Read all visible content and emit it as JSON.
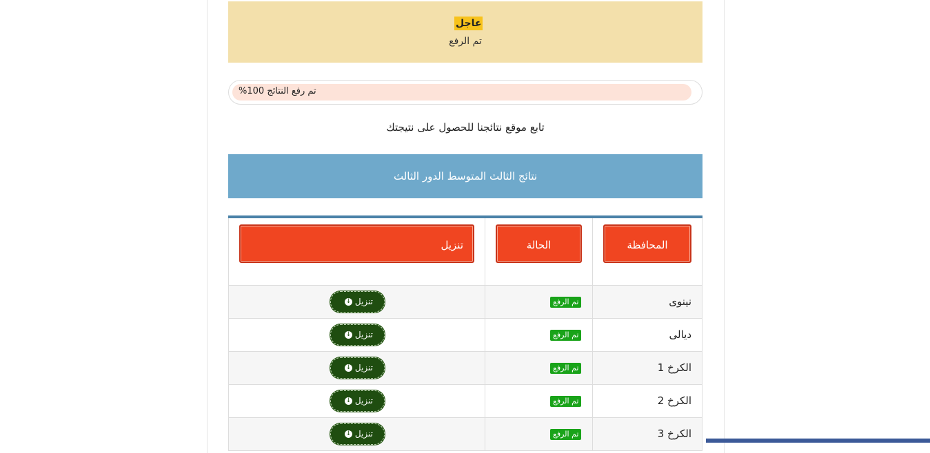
{
  "alert": {
    "badge": "عاجل",
    "text": "تم الرفع"
  },
  "progress": {
    "label": "تم رفع النتائج 100%",
    "percent": 100
  },
  "follow_text": "تابع موقع نتائجنا للحصول على نتيجتك",
  "section_title": "نتائج الثالث المتوسط الدور الثالث",
  "table": {
    "headers": {
      "governorate": "المحافظة",
      "status": "الحالة",
      "download": "تنزيل"
    },
    "rows": [
      {
        "governorate": "نينوى",
        "status": "تم الرفع",
        "download": "تنزيل"
      },
      {
        "governorate": "ديالى",
        "status": "تم الرفع",
        "download": "تنزيل"
      },
      {
        "governorate": "الكرخ 1",
        "status": "تم الرفع",
        "download": "تنزيل"
      },
      {
        "governorate": "الكرخ 2",
        "status": "تم الرفع",
        "download": "تنزيل"
      },
      {
        "governorate": "الكرخ 3",
        "status": "تم الرفع",
        "download": "تنزيل"
      }
    ]
  },
  "colors": {
    "alert_bg": "#f3e0ab",
    "badge_bg": "#f7c21b",
    "header_bg": "#6fa9cb",
    "table_head_button": "#f04521",
    "status_badge": "#19a319",
    "download_button": "#1f4d10"
  },
  "icons": {
    "download": "arrow-circle-down-icon"
  }
}
